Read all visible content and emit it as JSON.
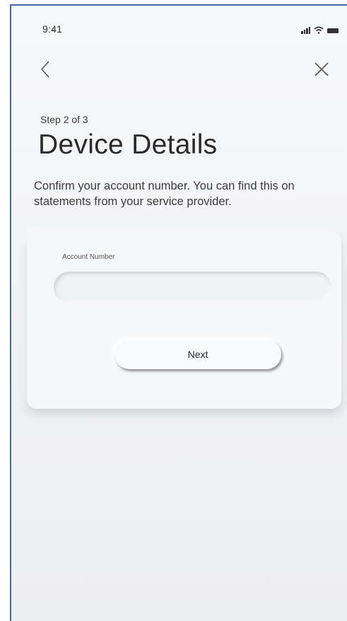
{
  "status_bar": {
    "time": "9:41",
    "icons": [
      "signal-icon",
      "wifi-icon",
      "battery-icon"
    ]
  },
  "navigation": {
    "back_icon": "chevron-left-icon",
    "close_icon": "close-icon"
  },
  "header": {
    "step": "Step 2 of 3",
    "title": "Device Details"
  },
  "instructions": "Confirm your account number. You can find this on statements from your service provider.",
  "form": {
    "account_label": "Account Number",
    "account_value": "",
    "account_placeholder": "",
    "next_label": "Next"
  },
  "colors": {
    "background": "#f3f4f7",
    "frame_border": "#4b63a6",
    "text": "#2b2b2b"
  }
}
